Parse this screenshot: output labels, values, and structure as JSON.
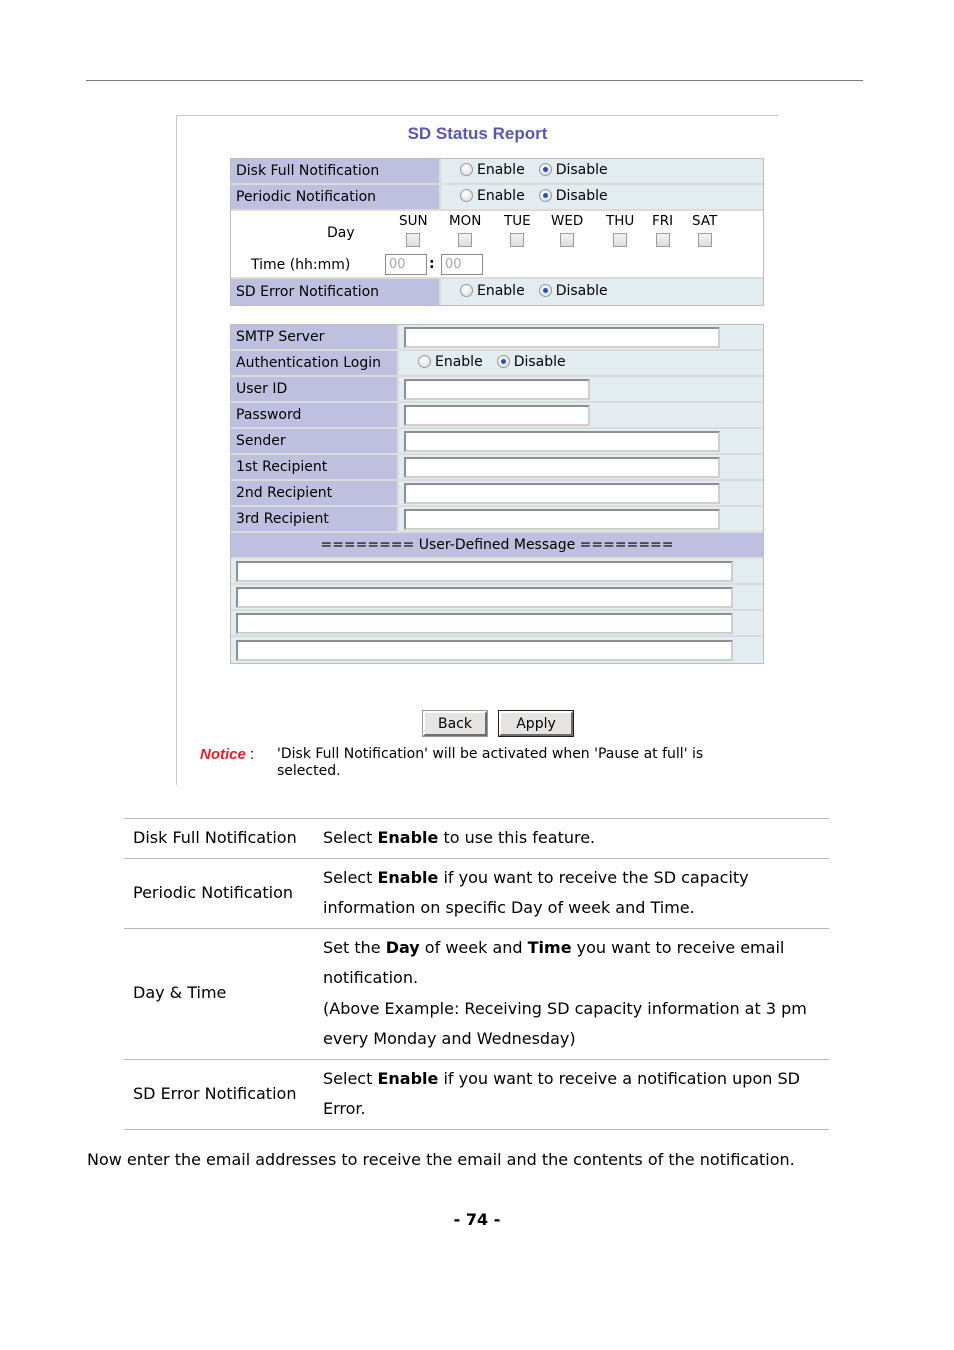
{
  "screenshot": {
    "title": "SD Status Report",
    "notifications": {
      "rows": [
        {
          "label": "Disk Full Notification",
          "enable": "Enable",
          "disable": "Disable",
          "selected": "Disable"
        },
        {
          "label": "Periodic Notification",
          "enable": "Enable",
          "disable": "Disable",
          "selected": "Disable"
        }
      ],
      "schedule": {
        "day_label": "Day",
        "days": [
          "SUN",
          "MON",
          "TUE",
          "WED",
          "THU",
          "FRI",
          "SAT"
        ],
        "days_checked": [
          false,
          false,
          false,
          false,
          false,
          false,
          false
        ],
        "time_label": "Time (hh:mm)",
        "hour_value": "00",
        "minute_value": "00",
        "separator": ":"
      },
      "sd_error": {
        "label": "SD Error Notification",
        "enable": "Enable",
        "disable": "Disable",
        "selected": "Disable"
      }
    },
    "smtp": {
      "server_label": "SMTP Server",
      "server_value": "",
      "auth_label": "Authentication Login",
      "auth_enable": "Enable",
      "auth_disable": "Disable",
      "auth_selected": "Disable",
      "user_id_label": "User ID",
      "user_id_value": "",
      "password_label": "Password",
      "password_value": "",
      "sender_label": "Sender",
      "sender_value": "",
      "recipients": [
        {
          "label": "1st Recipient",
          "value": ""
        },
        {
          "label": "2nd Recipient",
          "value": ""
        },
        {
          "label": "3rd Recipient",
          "value": ""
        }
      ],
      "message_header": "======== User-Defined Message ========",
      "message_lines": [
        "",
        "",
        "",
        ""
      ]
    },
    "buttons": {
      "back": "Back",
      "apply": "Apply"
    },
    "notice": {
      "label": "Notice",
      "colon": " :",
      "text": "'Disk Full Notification' will be activated when 'Pause at full' is selected."
    }
  },
  "description": {
    "rows": [
      {
        "key": "Disk Full Notification",
        "parts": [
          [
            "Select ",
            false
          ],
          [
            "Enable",
            true
          ],
          [
            " to use this feature.",
            false
          ]
        ]
      },
      {
        "key": "Periodic Notification",
        "parts": [
          [
            "Select ",
            false
          ],
          [
            "Enable",
            true
          ],
          [
            " if you want to receive the SD capacity information on specific Day of week and Time.",
            false
          ]
        ]
      },
      {
        "key": "Day & Time",
        "parts": [
          [
            "Set the ",
            false
          ],
          [
            "Day",
            true
          ],
          [
            " of week and ",
            false
          ],
          [
            "Time",
            true
          ],
          [
            " you want to receive email notification.",
            false
          ]
        ],
        "extra": "(Above Example: Receiving SD capacity information at 3 pm every Monday and Wednesday)"
      },
      {
        "key": "SD Error Notification",
        "parts": [
          [
            "Select ",
            false
          ],
          [
            "Enable",
            true
          ],
          [
            " if you want to receive a notification upon SD Error.",
            false
          ]
        ]
      }
    ]
  },
  "paragraph": "Now enter the email addresses to receive the email and the contents of the notification.",
  "page_number": "- 74 -"
}
